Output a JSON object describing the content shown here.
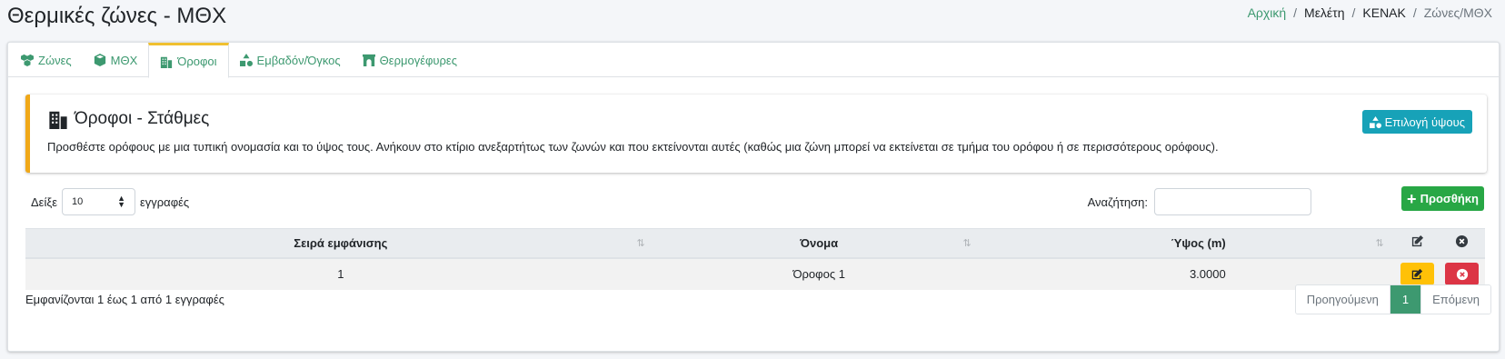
{
  "page": {
    "title": "Θερμικές ζώνες - ΜΘΧ"
  },
  "breadcrumb": [
    {
      "label": "Αρχική",
      "link": true
    },
    {
      "label": "Μελέτη",
      "link": false
    },
    {
      "label": "KENAK",
      "link": false
    },
    {
      "label": "Ζώνες/ΜΘΧ",
      "link": false
    }
  ],
  "tabs": [
    {
      "label": "Ζώνες",
      "icon": "cubes-icon",
      "active": false
    },
    {
      "label": "ΜΘΧ",
      "icon": "cube-icon",
      "active": false
    },
    {
      "label": "Όροφοι",
      "icon": "building-icon",
      "active": true
    },
    {
      "label": "Εμβαδόν/Όγκος",
      "icon": "shapes-icon",
      "active": false
    },
    {
      "label": "Θερμογέφυρες",
      "icon": "archway-icon",
      "active": false
    }
  ],
  "callout": {
    "title": "Όροφοι - Στάθμες",
    "text": "Προσθέστε ορόφους με μια τυπική ονομασία και το ύψος τους. Ανήκουν στο κτίριο ανεξαρτήτως των ζωνών και που εκτείνονται αυτές (καθώς μια ζώνη μπορεί να εκτείνεται σε τμήμα του ορόφου ή σε περισσότερους ορόφους).",
    "button_label": "Επιλογή ύψους"
  },
  "controls": {
    "show_label": "Δείξε",
    "page_size": "10",
    "entries_label": "εγγραφές",
    "search_label": "Αναζήτηση:",
    "search_value": "",
    "add_label": "Προσθήκη"
  },
  "table": {
    "columns": [
      "Σειρά εμφάνισης",
      "Όνομα",
      "Ύψος (m)"
    ],
    "rows": [
      {
        "order": "1",
        "name": "Όροφος 1",
        "height": "3.0000"
      }
    ]
  },
  "footer": {
    "info": "Εμφανίζονται 1 έως 1 από 1 εγγραφές",
    "prev_label": "Προηγούμενη",
    "current_page": "1",
    "next_label": "Επόμενη"
  },
  "colors": {
    "accent": "#3d9970",
    "warning_border": "#f0a818",
    "info_button": "#17a2b8",
    "success_button": "#28a745",
    "edit_button": "#ffc107",
    "delete_button": "#dc3545"
  }
}
